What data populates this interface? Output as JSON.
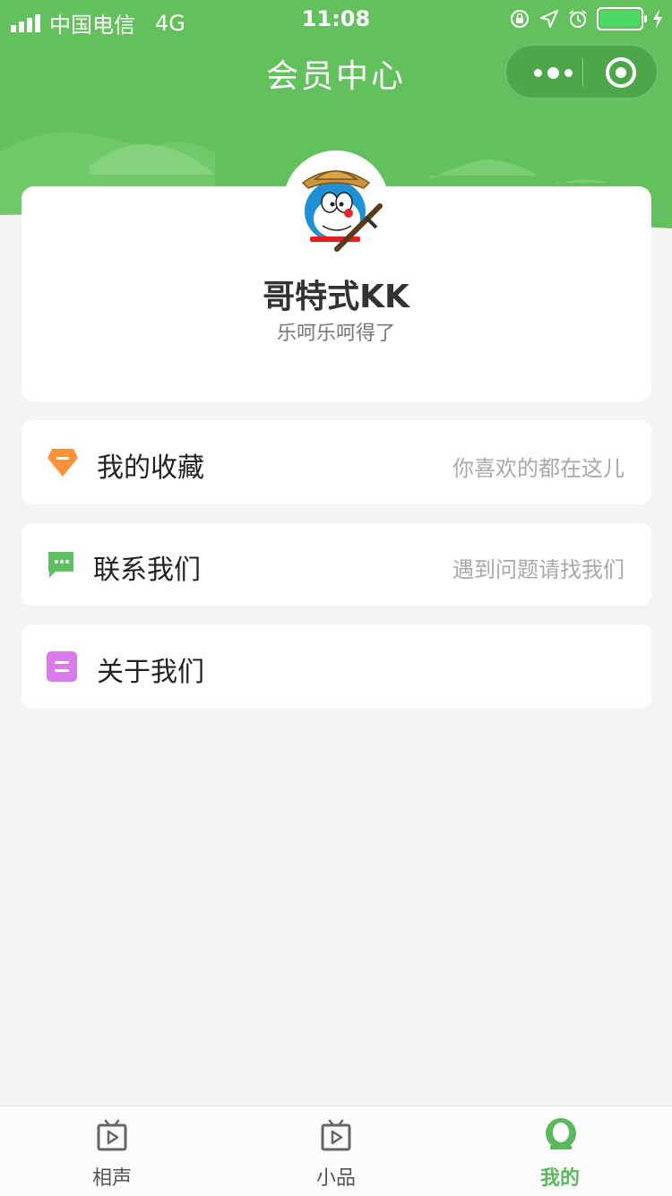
{
  "status_bar": {
    "carrier": "中国电信",
    "network": "4G",
    "time": "11:08"
  },
  "nav": {
    "title": "会员中心"
  },
  "profile": {
    "nickname": "哥特式KK",
    "signature": "乐呵乐呵得了"
  },
  "menu": {
    "items": [
      {
        "label": "我的收藏",
        "hint": "你喜欢的都在这儿",
        "icon": "gem-icon"
      },
      {
        "label": "联系我们",
        "hint": "遇到问题请找我们",
        "icon": "chat-bubble-icon"
      },
      {
        "label": "关于我们",
        "hint": "",
        "icon": "info-list-icon"
      }
    ]
  },
  "tabbar": {
    "tabs": [
      {
        "label": "相声",
        "icon": "tv-icon",
        "active": false
      },
      {
        "label": "小品",
        "icon": "tv-icon",
        "active": false
      },
      {
        "label": "我的",
        "icon": "user-icon",
        "active": true
      }
    ]
  },
  "colors": {
    "brand_green": "#62c15c",
    "gem_orange": "#f9923a",
    "chat_green": "#5fbf62",
    "about_purple": "#d97be8",
    "active_tab": "#5cb85c"
  }
}
